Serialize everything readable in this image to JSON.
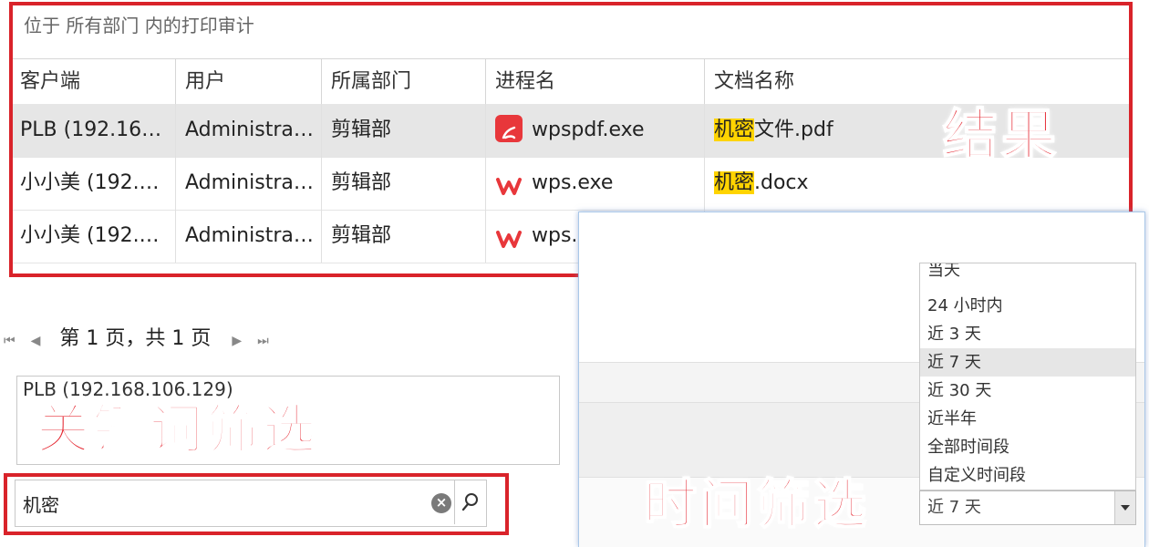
{
  "breadcrumb": "位于 所有部门 内的打印审计",
  "table": {
    "columns": [
      "客户端",
      "用户",
      "所属部门",
      "进程名",
      "文档名称"
    ],
    "rows": [
      {
        "client": "PLB (192.16…",
        "user": "Administra…",
        "dept": "剪辑部",
        "process": "wpspdf.exe",
        "process_icon": "pdf-icon",
        "doc_highlight": "机密",
        "doc_rest": "文件.pdf",
        "selected": true
      },
      {
        "client": "小小美 (192.…",
        "user": "Administra…",
        "dept": "剪辑部",
        "process": "wps.exe",
        "process_icon": "wps-icon",
        "doc_highlight": "机密",
        "doc_rest": ".docx",
        "selected": false
      },
      {
        "client": "小小美 (192.…",
        "user": "Administra…",
        "dept": "剪辑部",
        "process": "wps.",
        "process_icon": "wps-icon",
        "doc_highlight": "",
        "doc_rest": "",
        "selected": false
      }
    ]
  },
  "annotations": {
    "result": "结果",
    "keyword_filter": "关键词筛选",
    "time_filter": "时间筛选"
  },
  "pager": {
    "first": "⏮",
    "prev": "◀",
    "label": "第 1 页，共 1 页",
    "next": "▶",
    "last": "⏭"
  },
  "filter_list": {
    "item": "PLB (192.168.106.129)"
  },
  "search": {
    "value": "机密"
  },
  "time_dropdown": {
    "options": [
      "当天",
      "24 小时内",
      "近 3 天",
      "近 7 天",
      "近 30 天",
      "近半年",
      "全部时间段",
      "自定义时间段"
    ],
    "selected_index": 3,
    "selected": "近 7 天"
  },
  "colors": {
    "annotation_red": "#e52630",
    "highlight": "#ffd400",
    "box_red": "#d9232a"
  }
}
